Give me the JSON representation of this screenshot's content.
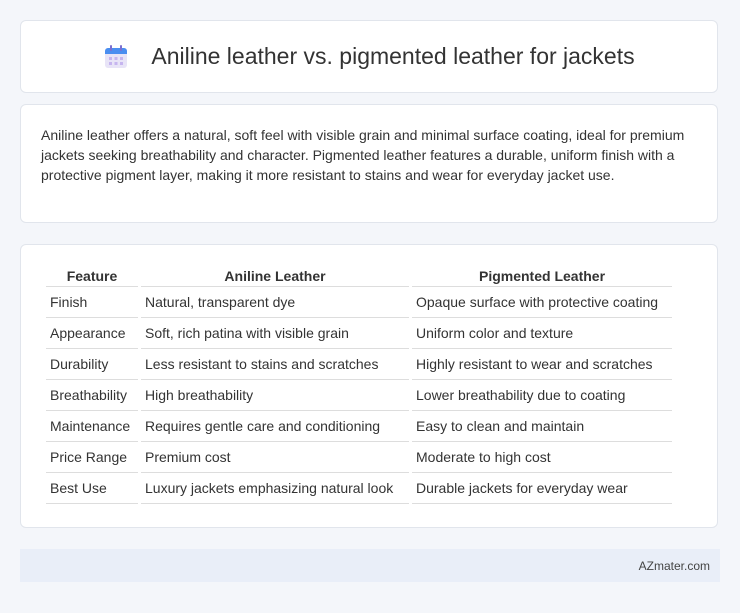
{
  "header": {
    "icon": "calendar-icon",
    "title": "Aniline leather vs. pigmented leather for jackets"
  },
  "summary": "Aniline leather offers a natural, soft feel with visible grain and minimal surface coating, ideal for premium jackets seeking breathability and character. Pigmented leather features a durable, uniform finish with a protective pigment layer, making it more resistant to stains and wear for everyday jacket use.",
  "table": {
    "headers": [
      "Feature",
      "Aniline Leather",
      "Pigmented Leather"
    ],
    "rows": [
      [
        "Finish",
        "Natural, transparent dye",
        "Opaque surface with protective coating"
      ],
      [
        "Appearance",
        "Soft, rich patina with visible grain",
        "Uniform color and texture"
      ],
      [
        "Durability",
        "Less resistant to stains and scratches",
        "Highly resistant to wear and scratches"
      ],
      [
        "Breathability",
        "High breathability",
        "Lower breathability due to coating"
      ],
      [
        "Maintenance",
        "Requires gentle care and conditioning",
        "Easy to clean and maintain"
      ],
      [
        "Price Range",
        "Premium cost",
        "Moderate to high cost"
      ],
      [
        "Best Use",
        "Luxury jackets emphasizing natural look",
        "Durable jackets for everyday wear"
      ]
    ]
  },
  "footer": {
    "brand": "AZmater.com"
  }
}
